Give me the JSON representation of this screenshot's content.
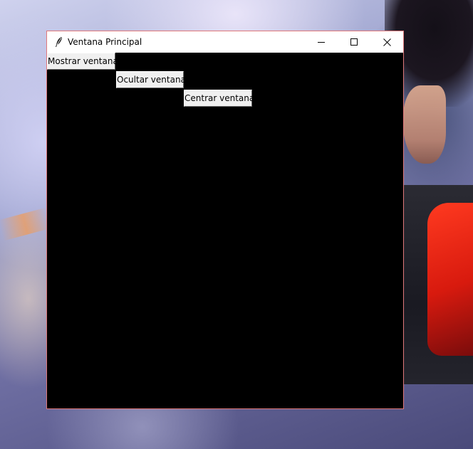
{
  "window": {
    "title": "Ventana Principal",
    "icon": "feather-icon",
    "controls": {
      "minimize_icon": "minimize-icon",
      "maximize_icon": "maximize-icon",
      "close_icon": "close-icon"
    }
  },
  "buttons": {
    "show_label": "Mostrar ventana",
    "hide_label": "Ocultar ventana",
    "center_label": "Centrar ventana"
  },
  "colors": {
    "client_background": "#000000",
    "button_face": "#f0f0f0",
    "window_border": "#e0787a"
  }
}
